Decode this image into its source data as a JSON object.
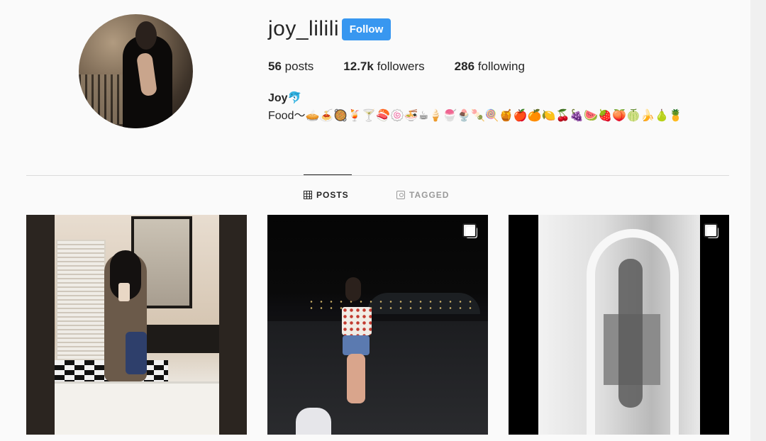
{
  "profile": {
    "username": "joy_lilili",
    "follow_label": "Follow",
    "posts_count": "56",
    "posts_label": "posts",
    "followers_count": "12.7k",
    "followers_label": "followers",
    "following_count": "286",
    "following_label": "following",
    "display_name": "Joy🐬",
    "bio": "Food～🥧🍝🥘🍹🍸🍣🍥🍜☕🍦🍧🍨🍡🍭🍯🍎🍊🍋🍒🍇🍉🍓🍑🍈🍌🍐🍍"
  },
  "tabs": [
    {
      "label": "POSTS",
      "icon": "grid-icon",
      "active": true
    },
    {
      "label": "TAGGED",
      "icon": "tag-icon",
      "active": false
    }
  ],
  "posts": [
    {
      "type": "single",
      "icon": ""
    },
    {
      "type": "carousel",
      "icon": "multiple-photos-icon"
    },
    {
      "type": "carousel",
      "icon": "multiple-photos-icon"
    }
  ],
  "colors": {
    "follow_button": "#3897f0",
    "background": "#fafafa",
    "text": "#262626",
    "inactive_tab": "#999999"
  }
}
